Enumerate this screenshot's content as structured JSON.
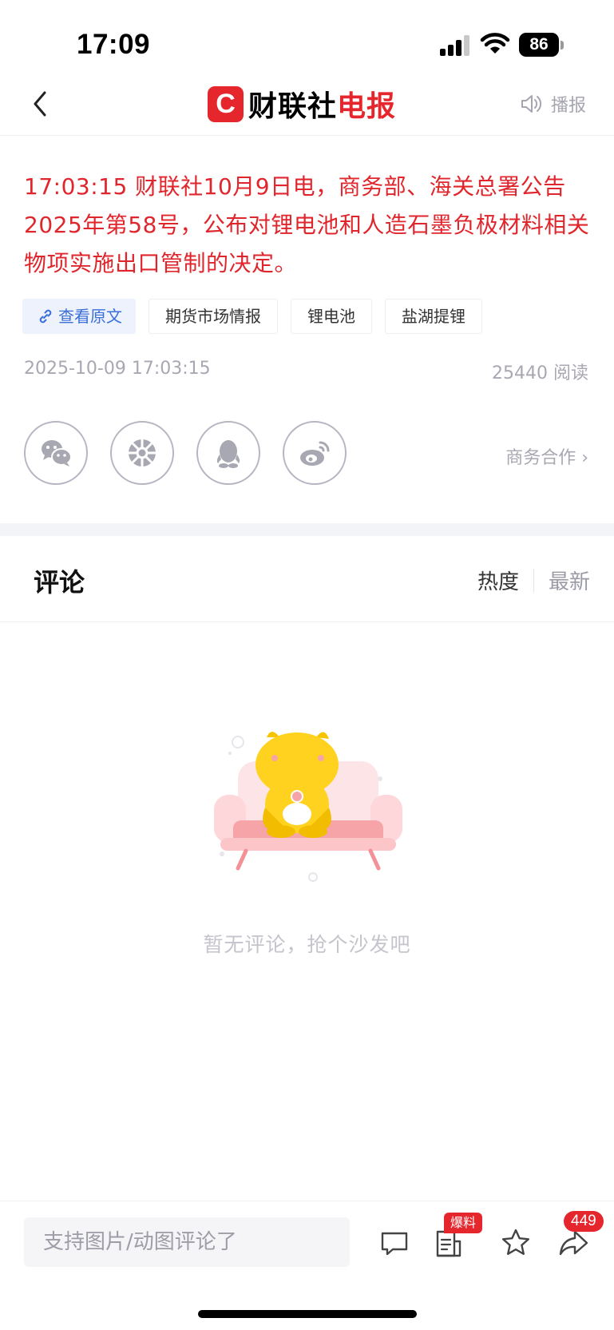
{
  "status_bar": {
    "time": "17:09",
    "battery": "86"
  },
  "nav": {
    "logo_mark": "C",
    "logo_text_a": "财联社",
    "logo_text_b": "电报",
    "broadcast_label": "播报",
    "back_icon": "chevron-left-icon",
    "broadcast_icon": "speaker-icon"
  },
  "article": {
    "text": "17:03:15  财联社10月9日电，商务部、海关总署公告2025年第58号，公布对锂电池和人造石墨负极材料相关物项实施出口管制的决定。",
    "tags": [
      "期货市场情报",
      "锂电池",
      "盐湖提锂"
    ],
    "source_link": "查看原文",
    "date": "2025-10-09 17:03:15",
    "reads": "25440 阅读",
    "business_coop": "商务合作 ›"
  },
  "share": {
    "icons": [
      "wechat-icon",
      "moments-icon",
      "qq-icon",
      "weibo-icon"
    ]
  },
  "comments": {
    "title": "评论",
    "sort_hot": "热度",
    "sort_new": "最新",
    "empty_text": "暂无评论，抢个沙发吧"
  },
  "bottom_bar": {
    "input_placeholder": "支持图片/动图评论了",
    "tips_badge": "爆料",
    "share_count": "449"
  },
  "colors": {
    "brand_red": "#e5262d",
    "article_red": "#e0262d",
    "link_blue": "#3b6fd8",
    "muted_gray": "#a8a8b3"
  }
}
